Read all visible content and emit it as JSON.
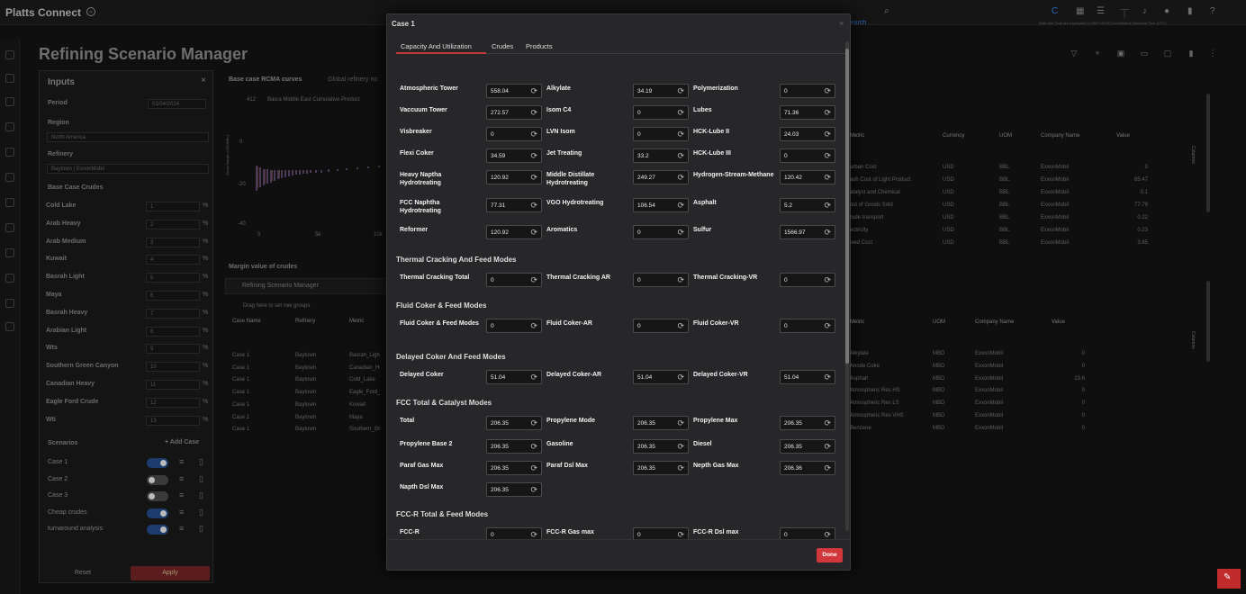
{
  "app": {
    "brand": "Platts Connect",
    "search_link": "Search",
    "timezone_note": "Date and Time are expressed in GMT+00:00 Coordinated Universal Time (UTC)"
  },
  "page": {
    "title": "Refining Scenario Manager"
  },
  "inputs": {
    "title": "Inputs",
    "period_label": "Period",
    "period_value": "01/04/2024",
    "region_label": "Region",
    "region_value": "North America",
    "refinery_label": "Refinery",
    "refinery_value": "Baytown | ExxonMobil",
    "crudes_section": "Base Case Crudes",
    "crudes": [
      "Cold Lake",
      "Arab Heavy",
      "Arab Medium",
      "Kuwait",
      "Basrah Light",
      "Maya",
      "Basrah Heavy",
      "Arabian Light",
      "Wts",
      "Southern Green Canyon",
      "Canadian Heavy",
      "Eagle Ford Crude",
      "Wti"
    ],
    "crude_values": [
      "1",
      "2",
      "3",
      "4",
      "5",
      "6",
      "7",
      "8",
      "9",
      "10",
      "11",
      "12",
      "13"
    ],
    "pct": "%",
    "scenarios_label": "Scenarios",
    "add_case": "+ Add Case",
    "scenarios": [
      {
        "name": "Case 1",
        "on": true
      },
      {
        "name": "Case 2",
        "on": false
      },
      {
        "name": "Case 3",
        "on": false
      },
      {
        "name": "Cheap crudes",
        "on": true
      },
      {
        "name": "turnaround analysis",
        "on": true
      }
    ],
    "reset": "Reset",
    "apply": "Apply"
  },
  "background": {
    "chart_title": "Base case RCMA curves",
    "chart_tab": "Global refinery no",
    "chart_legend": "Basra Middle East Cumulative Product",
    "chart_count": "412",
    "chart_ylabel": "Gross Margin (USD/BBL)",
    "chart_yticks": [
      "0",
      "-20",
      "-40"
    ],
    "chart_xticks": [
      "0",
      "5k",
      "10k"
    ],
    "margin_title": "Margin value of crudes",
    "grid_title": "Refining Scenario Manager",
    "drag_note": "Drag here to set row groups",
    "grid_cols": [
      "Case Name",
      "Refinery",
      "Metric"
    ],
    "grid_rows": [
      [
        "Case 1",
        "Baytown",
        "Basrah_Ligh"
      ],
      [
        "Case 1",
        "Baytown",
        "Canadian_H"
      ],
      [
        "Case 1",
        "Baytown",
        "Cold_Lake"
      ],
      [
        "Case 1",
        "Baytown",
        "Eagle_Ford_"
      ],
      [
        "Case 1",
        "Baytown",
        "Kuwait"
      ],
      [
        "Case 1",
        "Baytown",
        "Maya"
      ],
      [
        "Case 1",
        "Baytown",
        "Southern_Gr"
      ]
    ],
    "right1_cols": [
      "Metric",
      "Currency",
      "UOM",
      "Company Name",
      "Value"
    ],
    "right1_rows": [
      [
        "urban Cost",
        "USD",
        "BBL",
        "ExxonMobil",
        "0"
      ],
      [
        "ash Cost of Light Product",
        "USD",
        "BBL",
        "ExxonMobil",
        "85.47"
      ],
      [
        "atalyst and Chemical",
        "USD",
        "BBL",
        "ExxonMobil",
        "0.1"
      ],
      [
        "ost of Goods Sold",
        "USD",
        "BBL",
        "ExxonMobil",
        "77.79"
      ],
      [
        "rude transport",
        "USD",
        "BBL",
        "ExxonMobil",
        "0.22"
      ],
      [
        "ectricity",
        "USD",
        "BBL",
        "ExxonMobil",
        "0.23"
      ],
      [
        "ixed Cost",
        "USD",
        "BBL",
        "ExxonMobil",
        "3.85"
      ]
    ],
    "right2_cols": [
      "Metric",
      "UOM",
      "Company Name",
      "Value"
    ],
    "right2_rows": [
      [
        "Alkylate",
        "MBD",
        "ExxonMobil",
        "0"
      ],
      [
        "Anode Coke",
        "MBD",
        "ExxonMobil",
        "0"
      ],
      [
        "Asphalt",
        "MBD",
        "ExxonMobil",
        "23.6"
      ],
      [
        "Atmospheric Res HS",
        "MBD",
        "ExxonMobil",
        "0"
      ],
      [
        "Atmospheric Res LS",
        "MBD",
        "ExxonMobil",
        "0"
      ],
      [
        "Atmospheric Res VHS",
        "MBD",
        "ExxonMobil",
        "0"
      ],
      [
        "Benzene",
        "MBD",
        "ExxonMobil",
        "0"
      ]
    ],
    "columns_label": "Columns"
  },
  "modal": {
    "title": "Case 1",
    "tabs": [
      "Capacity And Utilization",
      "Crudes",
      "Products"
    ],
    "refresh_glyph": "⟳",
    "sections": [
      {
        "title": "",
        "fields": [
          [
            "Atmospheric Tower",
            "558.04"
          ],
          [
            "Alkylate",
            "34.19"
          ],
          [
            "Polymerization",
            "0"
          ],
          [
            "Vaccuum Tower",
            "272.57"
          ],
          [
            "Isom C4",
            "0"
          ],
          [
            "Lubes",
            "71.36"
          ],
          [
            "Visbreaker",
            "0"
          ],
          [
            "LVN Isom",
            "0"
          ],
          [
            "HCK-Lube II",
            "24.03"
          ],
          [
            "Flexi Coker",
            "34.59"
          ],
          [
            "Jet Treating",
            "33.2"
          ],
          [
            "HCK-Lube III",
            "0"
          ],
          [
            "Heavy Naptha Hydrotreating",
            "120.92"
          ],
          [
            "Middle Distillate Hydrotreating",
            "249.27"
          ],
          [
            "Hydrogen-Stream-Methane",
            "120.42"
          ],
          [
            "FCC Naphtha Hydrotreating",
            "77.31"
          ],
          [
            "VGO Hydrotreating",
            "106.54"
          ],
          [
            "Asphalt",
            "5.2"
          ],
          [
            "Reformer",
            "120.92"
          ],
          [
            "Aromatics",
            "0"
          ],
          [
            "Sulfur",
            "1566.97"
          ]
        ]
      },
      {
        "title": "Thermal Cracking And Feed Modes",
        "fields": [
          [
            "Thermal Cracking Total",
            "0"
          ],
          [
            "Thermal Cracking AR",
            "0"
          ],
          [
            "Thermal Cracking-VR",
            "0"
          ]
        ]
      },
      {
        "title": "Fluid Coker & Feed Modes",
        "fields": [
          [
            "Fluid Coker & Feed Modes",
            "0"
          ],
          [
            "Fluid Coker-AR",
            "0"
          ],
          [
            "Fluid Coker-VR",
            "0"
          ]
        ]
      },
      {
        "title": "Delayed Coker And Feed Modes",
        "fields": [
          [
            "Delayed Coker",
            "51.04"
          ],
          [
            "Delayed Coker-AR",
            "51.04"
          ],
          [
            "Delayed Coker-VR",
            "51.04"
          ]
        ]
      },
      {
        "title": "FCC Total & Catalyst Modes",
        "fields": [
          [
            "Total",
            "206.35"
          ],
          [
            "Propylene Mode",
            "206.35"
          ],
          [
            "Propylene Max",
            "206.35"
          ],
          [
            "Propylene Base 2",
            "206.35"
          ],
          [
            "Gasoline",
            "206.35"
          ],
          [
            "Diesel",
            "206.35"
          ],
          [
            "Paraf Gas Max",
            "206.35"
          ],
          [
            "Paraf Dsl Max",
            "206.35"
          ],
          [
            "Nepth Gas Max",
            "206.36"
          ],
          [
            "Napth Dsl Max",
            "206.35"
          ]
        ]
      },
      {
        "title": "FCC-R Total & Feed Modes",
        "fields": [
          [
            "FCC-R",
            "0"
          ],
          [
            "FCC-R Gas max",
            "0"
          ],
          [
            "FCC-R Dsl max",
            "0"
          ]
        ]
      }
    ],
    "done": "Done"
  }
}
